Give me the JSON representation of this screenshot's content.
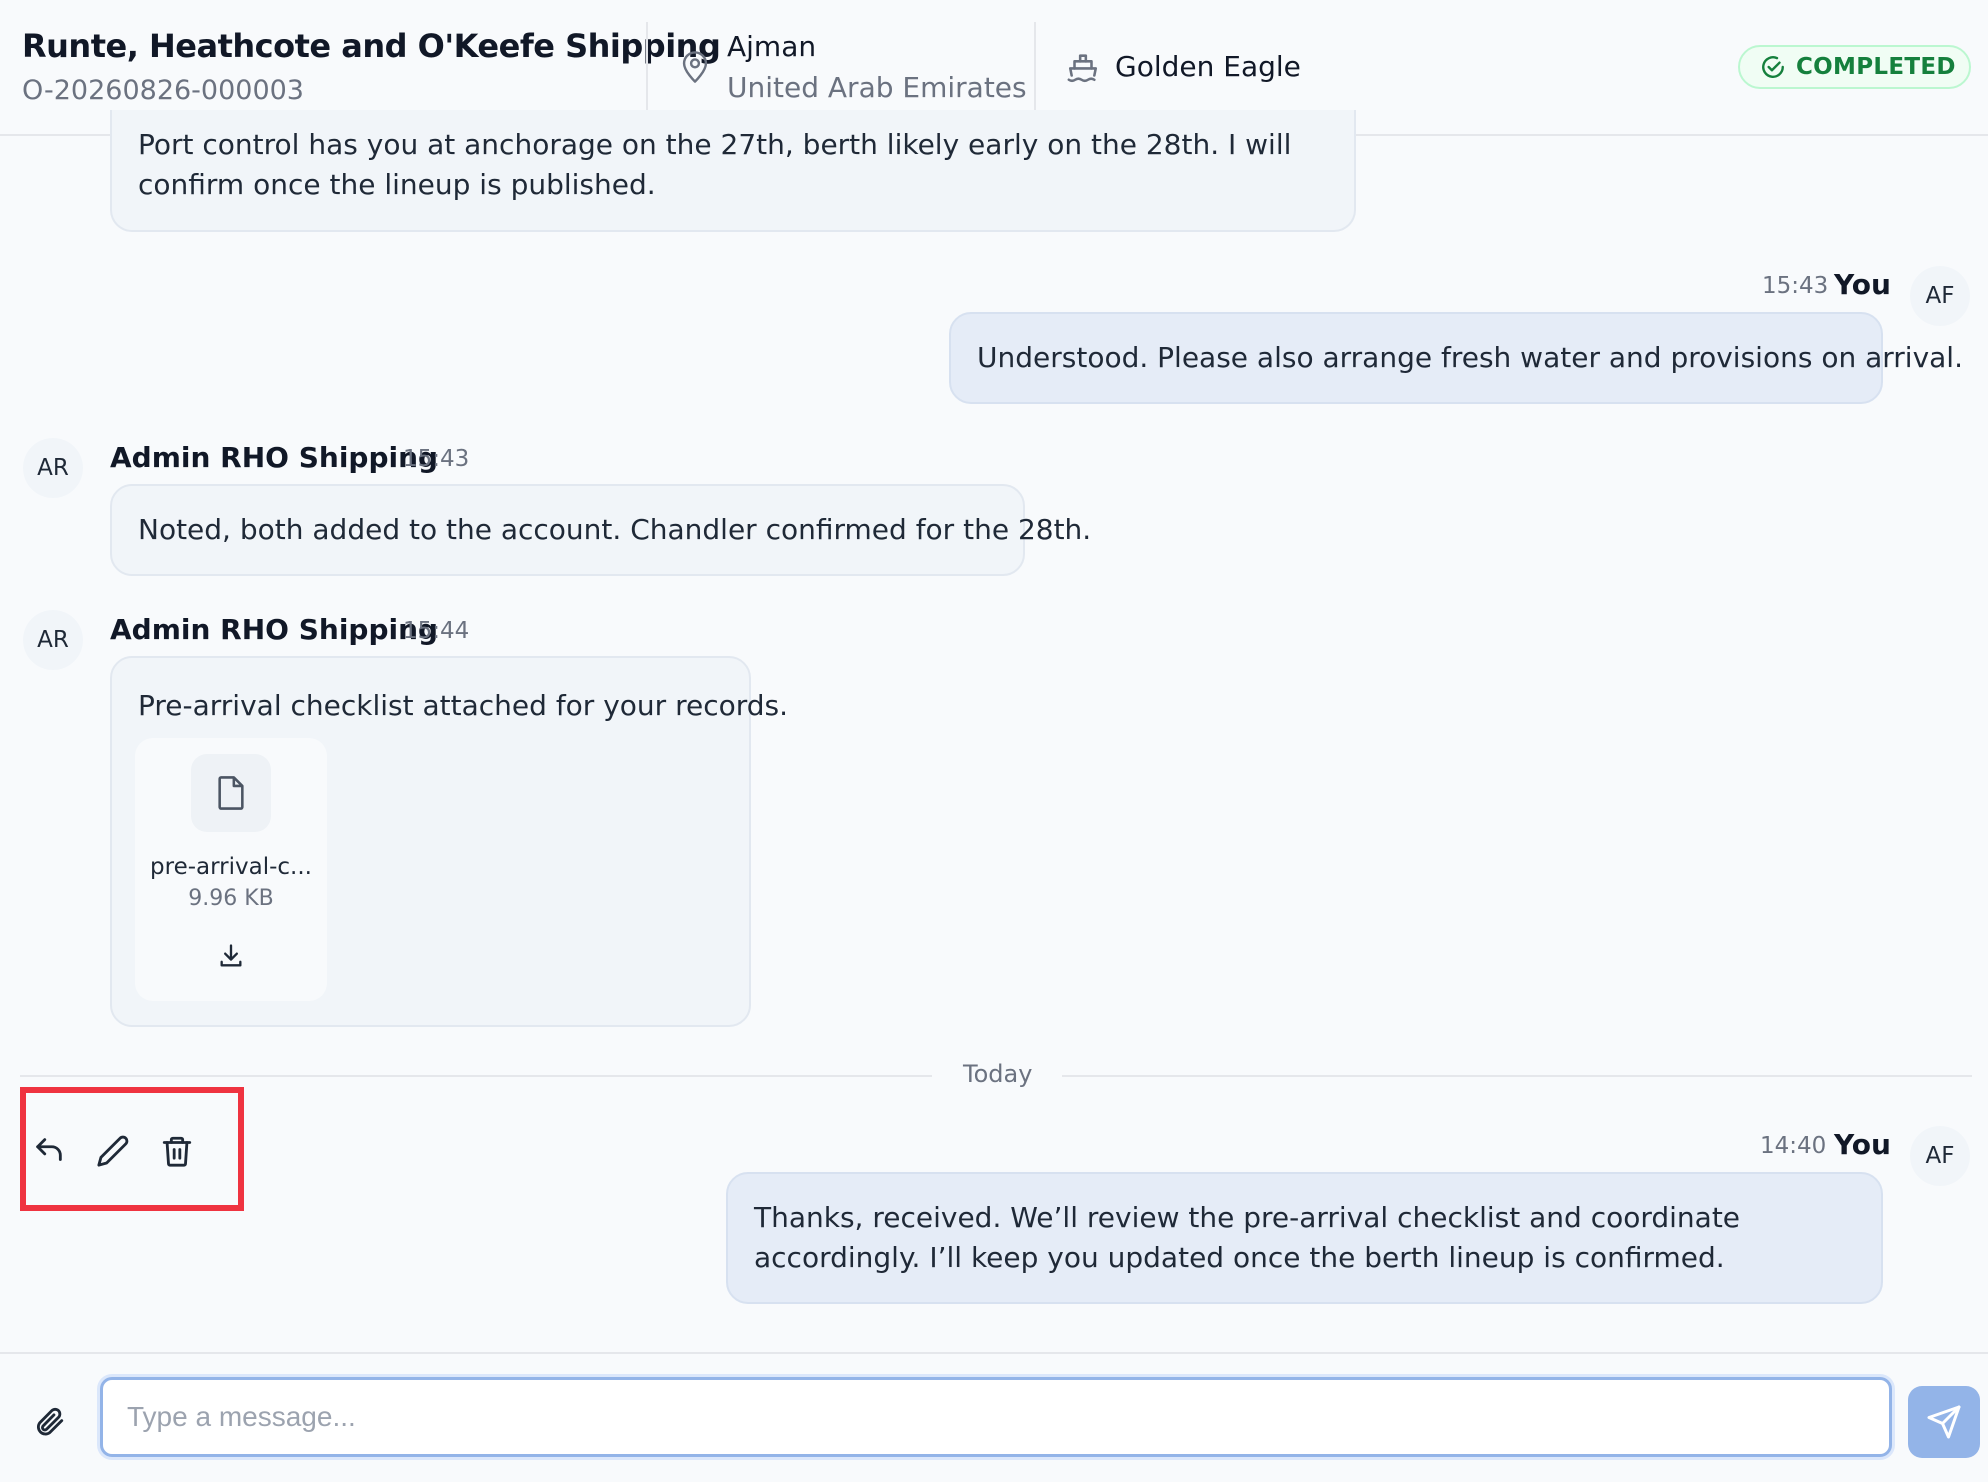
{
  "header": {
    "title": "Runte, Heathcote and O'Keefe Shipping",
    "order_id": "O-20260826-000003",
    "location": {
      "city": "Ajman",
      "country": "United Arab Emirates"
    },
    "vessel": "Golden Eagle",
    "status": "COMPLETED",
    "status_color": "#15803d"
  },
  "messages": [
    {
      "direction": "in",
      "text": "Port control has you at anchorage on the 27th, berth likely early on the 28th. I will confirm once the lineup is published."
    },
    {
      "direction": "out",
      "sender": "You",
      "time": "15:43",
      "avatar": "AF",
      "text": "Understood. Please also arrange fresh water and provisions on arrival."
    },
    {
      "direction": "in",
      "sender": "Admin RHO Shipping",
      "time": "15:43",
      "avatar": "AR",
      "text": "Noted, both added to the account. Chandler confirmed for the 28th."
    },
    {
      "direction": "in",
      "sender": "Admin RHO Shipping",
      "time": "15:44",
      "avatar": "AR",
      "text": "Pre-arrival checklist attached for your records.",
      "attachment": {
        "name": "pre-arrival-c...",
        "size": "9.96 KB",
        "icon": "file-icon"
      }
    },
    {
      "direction": "out",
      "sender": "You",
      "time": "14:40",
      "avatar": "AF",
      "text": "Thanks, received. We’ll review the pre-arrival checklist and coordinate accordingly. I’ll keep you updated once the berth lineup is confirmed."
    }
  ],
  "date_divider": "Today",
  "actions": [
    "reply-icon",
    "edit-icon",
    "delete-icon"
  ],
  "composer": {
    "placeholder": "Type a message...",
    "value": "",
    "accent": "#93b4e8"
  },
  "highlight_color": "#ef3340"
}
